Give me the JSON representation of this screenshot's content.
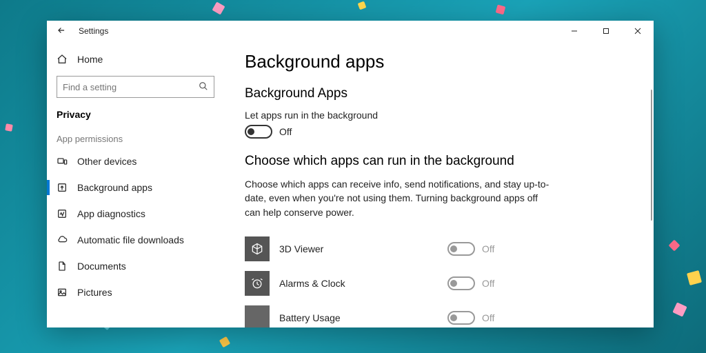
{
  "window": {
    "title": "Settings"
  },
  "sidebar": {
    "home": "Home",
    "search_placeholder": "Find a setting",
    "section": "Privacy",
    "group": "App permissions",
    "items": [
      {
        "label": "Other devices"
      },
      {
        "label": "Background apps"
      },
      {
        "label": "App diagnostics"
      },
      {
        "label": "Automatic file downloads"
      },
      {
        "label": "Documents"
      },
      {
        "label": "Pictures"
      }
    ]
  },
  "main": {
    "title": "Background apps",
    "subhead1": "Background Apps",
    "master_label": "Let apps run in the background",
    "master_state": "Off",
    "subhead2": "Choose which apps can run in the background",
    "paragraph": "Choose which apps can receive info, send notifications, and stay up-to-date, even when you're not using them. Turning background apps off can help conserve power.",
    "apps": [
      {
        "name": "3D Viewer",
        "state": "Off"
      },
      {
        "name": "Alarms & Clock",
        "state": "Off"
      },
      {
        "name": "Battery Usage",
        "state": "Off"
      }
    ]
  }
}
